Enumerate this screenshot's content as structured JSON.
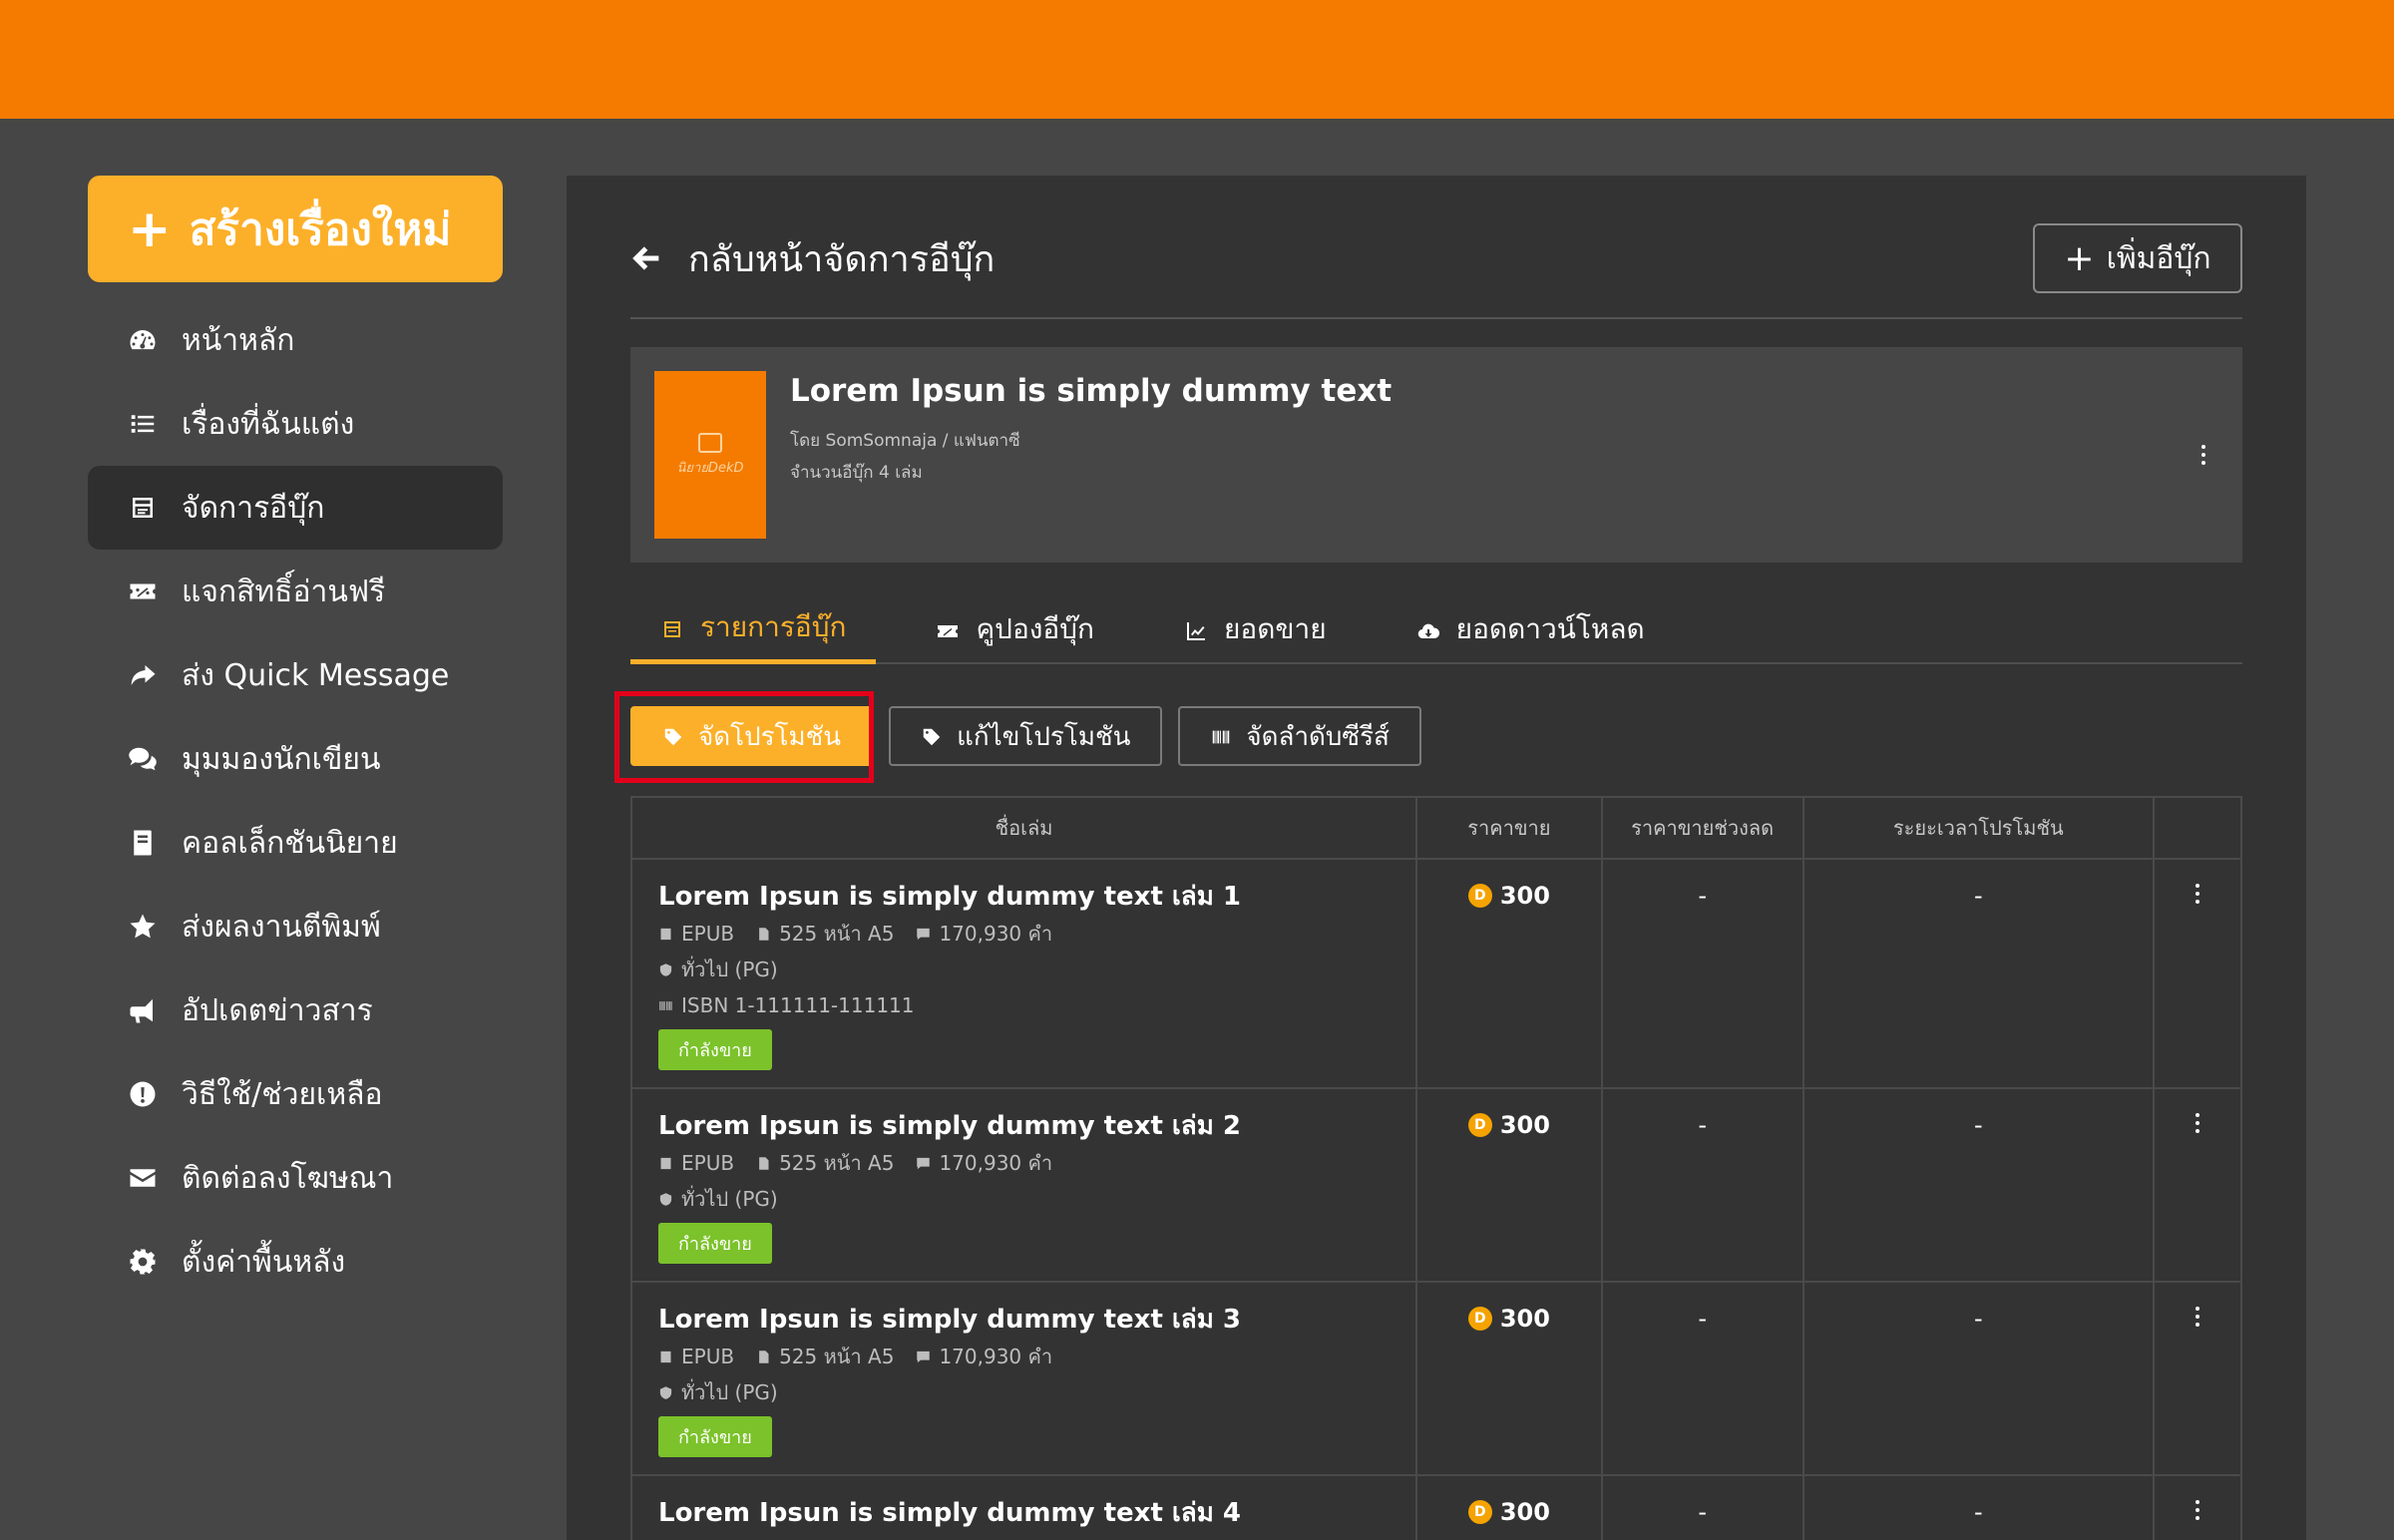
{
  "sidebar": {
    "create_label": "สร้างเรื่องใหม่",
    "items": [
      {
        "label": "หน้าหลัก",
        "icon": "dashboard-icon"
      },
      {
        "label": "เรื่องที่ฉันแต่ง",
        "icon": "list-icon"
      },
      {
        "label": "จัดการอีบุ๊ก",
        "icon": "ebook-icon",
        "active": true
      },
      {
        "label": "แจกสิทธิ์อ่านฟรี",
        "icon": "ticket-icon"
      },
      {
        "label": "ส่ง Quick Message",
        "icon": "share-icon"
      },
      {
        "label": "มุมมองนักเขียน",
        "icon": "comments-icon"
      },
      {
        "label": "คอลเล็กชันนิยาย",
        "icon": "book-icon"
      },
      {
        "label": "ส่งผลงานตีพิมพ์",
        "icon": "star-icon"
      },
      {
        "label": "อัปเดตข่าวสาร",
        "icon": "megaphone-icon"
      },
      {
        "label": "วิธีใช้/ช่วยเหลือ",
        "icon": "help-icon"
      },
      {
        "label": "ติดต่อลงโฆษณา",
        "icon": "mail-icon"
      },
      {
        "label": "ตั้งค่าพื้นหลัง",
        "icon": "gear-icon"
      }
    ]
  },
  "header": {
    "back_label": "กลับหน้าจัดการอีบุ๊ก",
    "add_ebook_label": "เพิ่มอีบุ๊ก"
  },
  "book": {
    "title": "Lorem Ipsun is simply dummy text",
    "author_line": "โดย SomSomnaja / แฟนตาซี",
    "count_line": "จำนวนอีบุ๊ก 4 เล่ม",
    "cover_brand": "นิยายDekD"
  },
  "tabs": [
    {
      "label": "รายการอีบุ๊ก",
      "icon": "ebook-icon",
      "active": true
    },
    {
      "label": "คูปองอีบุ๊ก",
      "icon": "ticket-icon"
    },
    {
      "label": "ยอดขาย",
      "icon": "chart-icon"
    },
    {
      "label": "ยอดดาวน์โหลด",
      "icon": "cloud-download-icon"
    }
  ],
  "actions": [
    {
      "label": "จัดโปรโมชัน",
      "icon": "tag-icon"
    },
    {
      "label": "แก้ไขโปรโมชัน",
      "icon": "tag-icon"
    },
    {
      "label": "จัดลำดับซีรีส์",
      "icon": "barcode-icon"
    }
  ],
  "table": {
    "headers": [
      "ชื่อเล่ม",
      "ราคาขาย",
      "ราคาขายช่วงลด",
      "ระยะเวลาโปรโมชัน",
      ""
    ],
    "rows": [
      {
        "title": "Lorem Ipsun is simply dummy text เล่ม 1",
        "format": "EPUB",
        "pages": "525 หน้า A5",
        "words": "170,930 คำ",
        "rating": "ทั่วไป (PG)",
        "isbn": "ISBN 1-111111-111111",
        "status": "กำลังขาย",
        "price": "300",
        "sale_price": "-",
        "promo_period": "-"
      },
      {
        "title": "Lorem Ipsun is simply dummy text เล่ม 2",
        "format": "EPUB",
        "pages": "525 หน้า A5",
        "words": "170,930 คำ",
        "rating": "ทั่วไป (PG)",
        "status": "กำลังขาย",
        "price": "300",
        "sale_price": "-",
        "promo_period": "-"
      },
      {
        "title": "Lorem Ipsun is simply dummy text เล่ม 3",
        "format": "EPUB",
        "pages": "525 หน้า A5",
        "words": "170,930 คำ",
        "rating": "ทั่วไป (PG)",
        "status": "กำลังขาย",
        "price": "300",
        "sale_price": "-",
        "promo_period": "-"
      },
      {
        "title": "Lorem Ipsun is simply dummy text เล่ม 4",
        "price": "300",
        "sale_price": "-",
        "promo_period": "-"
      }
    ]
  },
  "colors": {
    "topbar": "#f47b00",
    "accent": "#fcb02a",
    "status": "#7cc22b",
    "highlight": "#e3001b"
  },
  "coin_symbol": "D"
}
